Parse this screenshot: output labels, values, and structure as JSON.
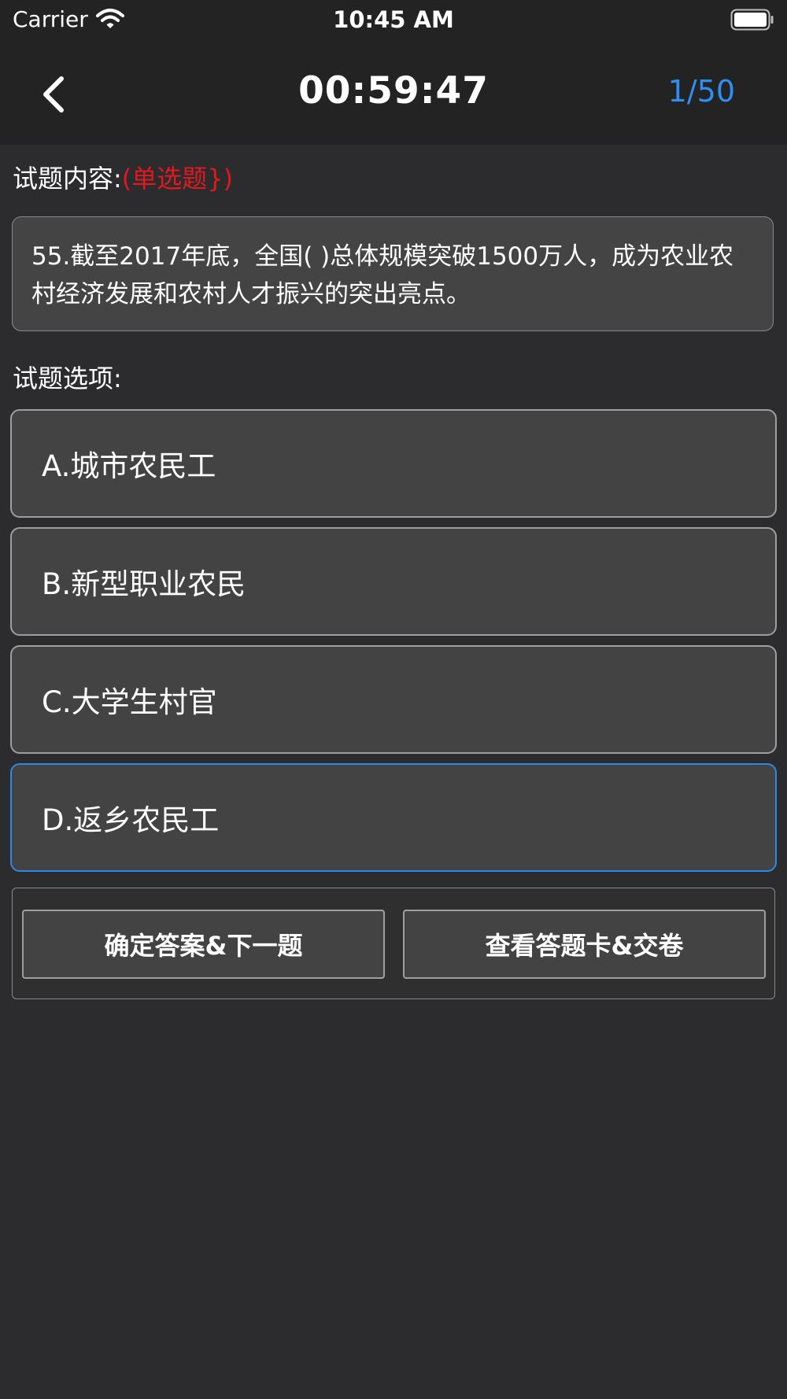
{
  "status_bar": {
    "carrier": "Carrier",
    "time": "10:45 AM",
    "wifi_icon": "wifi-icon",
    "battery_icon": "battery-icon"
  },
  "nav": {
    "back_icon": "chevron-left-icon",
    "timer": "00:59:47",
    "progress": "1/50",
    "progress_color": "#2f8ef3"
  },
  "question": {
    "content_label": "试题内容:",
    "type_label": "(单选题})",
    "type_color": "#e0191f",
    "text": "55.截至2017年底，全国( )总体规模突破1500万人，成为农业农村经济发展和农村人才振兴的突出亮点。",
    "options_label": "试题选项:"
  },
  "options": [
    {
      "label": "A.城市农民工",
      "selected": false
    },
    {
      "label": "B.新型职业农民",
      "selected": false
    },
    {
      "label": "C.大学生村官",
      "selected": false
    },
    {
      "label": "D.返乡农民工",
      "selected": true
    }
  ],
  "selected_border_color": "#2e88e8",
  "actions": {
    "confirm_next": "确定答案&下一题",
    "view_card_submit": "查看答题卡&交卷"
  }
}
